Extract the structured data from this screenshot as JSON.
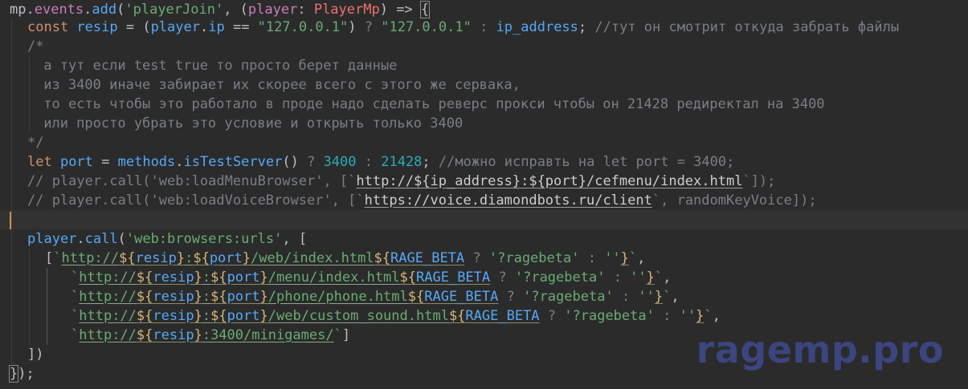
{
  "editor": {
    "theme": "dark",
    "colors": {
      "background": "#2b2b2b",
      "current_line": "#323232",
      "keyword": "#cf8e6d",
      "function": "#56a8f5",
      "property": "#c77dbb",
      "string": "#6aab73",
      "number": "#2aacb8",
      "comment": "#7a7e85",
      "template_interpolation": "#d5b778",
      "type": "#ef6e6e"
    },
    "lines": [
      {
        "tokens": [
          {
            "t": "mp",
            "c": "id"
          },
          {
            "t": ".",
            "c": "op"
          },
          {
            "t": "events",
            "c": "prop"
          },
          {
            "t": ".",
            "c": "op"
          },
          {
            "t": "add",
            "c": "fn"
          },
          {
            "t": "(",
            "c": "par"
          },
          {
            "t": "'playerJoin'",
            "c": "str"
          },
          {
            "t": ", (",
            "c": "op"
          },
          {
            "t": "player",
            "c": "prop"
          },
          {
            "t": ": ",
            "c": "op"
          },
          {
            "t": "PlayerMp",
            "c": "type"
          },
          {
            "t": ") => ",
            "c": "op"
          },
          {
            "t": "{",
            "c": "brace"
          }
        ]
      },
      {
        "tokens": [
          {
            "t": "const ",
            "c": "kw"
          },
          {
            "t": "resip",
            "c": "var"
          },
          {
            "t": " = (",
            "c": "op"
          },
          {
            "t": "player",
            "c": "var"
          },
          {
            "t": ".",
            "c": "op"
          },
          {
            "t": "ip",
            "c": "fn"
          },
          {
            "t": " == ",
            "c": "op"
          },
          {
            "t": "\"127.0.0.1\"",
            "c": "str"
          },
          {
            "t": ") ",
            "c": "op"
          },
          {
            "t": "? ",
            "c": "tern"
          },
          {
            "t": "\"127.0.0.1\"",
            "c": "str"
          },
          {
            "t": " : ",
            "c": "tern"
          },
          {
            "t": "ip_address",
            "c": "var"
          },
          {
            "t": "; ",
            "c": "op"
          },
          {
            "t": "//тут он смотрит откуда забрать файлы",
            "c": "cm"
          }
        ]
      },
      {
        "tokens": [
          {
            "t": "/*",
            "c": "cm"
          }
        ]
      },
      {
        "tokens": [
          {
            "t": " а тут если test true то просто берет данные",
            "c": "cm"
          }
        ]
      },
      {
        "tokens": [
          {
            "t": " из 3400 иначе забирает их скорее всего с этого же сервака,",
            "c": "cm"
          }
        ]
      },
      {
        "tokens": [
          {
            "t": " то есть чтобы это работало в проде надо сделать реверс прокси чтобы он 21428 редиректал на 3400",
            "c": "cm"
          }
        ]
      },
      {
        "tokens": [
          {
            "t": " или просто убрать это условие и открыть только 3400",
            "c": "cm"
          }
        ]
      },
      {
        "tokens": [
          {
            "t": "*/",
            "c": "cm"
          }
        ]
      },
      {
        "tokens": [
          {
            "t": "let ",
            "c": "kw"
          },
          {
            "t": "port",
            "c": "var"
          },
          {
            "t": " = ",
            "c": "op"
          },
          {
            "t": "methods",
            "c": "var"
          },
          {
            "t": ".",
            "c": "op"
          },
          {
            "t": "isTestServer",
            "c": "fn"
          },
          {
            "t": "() ",
            "c": "op"
          },
          {
            "t": "? ",
            "c": "tern"
          },
          {
            "t": "3400",
            "c": "num"
          },
          {
            "t": " : ",
            "c": "tern"
          },
          {
            "t": "21428",
            "c": "num"
          },
          {
            "t": "; ",
            "c": "op"
          },
          {
            "t": "//можно исправть на let port = 3400;",
            "c": "cm"
          }
        ]
      },
      {
        "tokens": [
          {
            "t": "// player.call('web:loadMenuBrowser', [`",
            "c": "cm"
          },
          {
            "t": "http://${ip_address}:${port}/cefmenu/index.html",
            "c": "url"
          },
          {
            "t": "`]);",
            "c": "cm"
          }
        ]
      },
      {
        "tokens": [
          {
            "t": "// player.call('web:loadVoiceBrowser', [`",
            "c": "cm"
          },
          {
            "t": "https://voice.diamondbots.ru/client",
            "c": "url"
          },
          {
            "t": "`, randomKeyVoice]);",
            "c": "cm"
          }
        ]
      },
      {
        "tokens": []
      },
      {
        "tokens": [
          {
            "t": "player",
            "c": "var"
          },
          {
            "t": ".",
            "c": "op"
          },
          {
            "t": "call",
            "c": "fn"
          },
          {
            "t": "(",
            "c": "par"
          },
          {
            "t": "'web:browsers:urls'",
            "c": "str"
          },
          {
            "t": ", [",
            "c": "op"
          }
        ]
      },
      {
        "tokens": [
          {
            "t": "[",
            "c": "op"
          },
          {
            "t": "`",
            "c": "bt"
          },
          {
            "t": "http://",
            "c": "url-s"
          },
          {
            "t": "${",
            "c": "tpl"
          },
          {
            "t": "resip",
            "c": "var"
          },
          {
            "t": "}",
            "c": "tpl"
          },
          {
            "t": ":",
            "c": "url-s"
          },
          {
            "t": "${",
            "c": "tpl"
          },
          {
            "t": "port",
            "c": "var"
          },
          {
            "t": "}",
            "c": "tpl"
          },
          {
            "t": "/web/index.html",
            "c": "url-s"
          },
          {
            "t": "${",
            "c": "tpl"
          },
          {
            "t": "RAGE_BETA",
            "c": "const"
          },
          {
            "t": " ? ",
            "c": "tern"
          },
          {
            "t": "'?ragebeta'",
            "c": "str"
          },
          {
            "t": " : ",
            "c": "tern"
          },
          {
            "t": "''",
            "c": "str"
          },
          {
            "t": "}",
            "c": "tpl"
          },
          {
            "t": "`",
            "c": "bt"
          },
          {
            "t": ",",
            "c": "op"
          }
        ]
      },
      {
        "tokens": [
          {
            "t": "`",
            "c": "bt"
          },
          {
            "t": "http://",
            "c": "url-s"
          },
          {
            "t": "${",
            "c": "tpl"
          },
          {
            "t": "resip",
            "c": "var"
          },
          {
            "t": "}",
            "c": "tpl"
          },
          {
            "t": ":",
            "c": "url-s"
          },
          {
            "t": "${",
            "c": "tpl"
          },
          {
            "t": "port",
            "c": "var"
          },
          {
            "t": "}",
            "c": "tpl"
          },
          {
            "t": "/menu/index.html",
            "c": "url-s"
          },
          {
            "t": "${",
            "c": "tpl"
          },
          {
            "t": "RAGE_BETA",
            "c": "const"
          },
          {
            "t": " ? ",
            "c": "tern"
          },
          {
            "t": "'?ragebeta'",
            "c": "str"
          },
          {
            "t": " : ",
            "c": "tern"
          },
          {
            "t": "''",
            "c": "str"
          },
          {
            "t": "}",
            "c": "tpl"
          },
          {
            "t": "`",
            "c": "bt"
          },
          {
            "t": ",",
            "c": "op"
          }
        ]
      },
      {
        "tokens": [
          {
            "t": "`",
            "c": "bt"
          },
          {
            "t": "http://",
            "c": "url-s"
          },
          {
            "t": "${",
            "c": "tpl"
          },
          {
            "t": "resip",
            "c": "var"
          },
          {
            "t": "}",
            "c": "tpl"
          },
          {
            "t": ":",
            "c": "url-s"
          },
          {
            "t": "${",
            "c": "tpl"
          },
          {
            "t": "port",
            "c": "var"
          },
          {
            "t": "}",
            "c": "tpl"
          },
          {
            "t": "/phone/phone.html",
            "c": "url-s"
          },
          {
            "t": "${",
            "c": "tpl"
          },
          {
            "t": "RAGE_BETA",
            "c": "const"
          },
          {
            "t": " ? ",
            "c": "tern"
          },
          {
            "t": "'?ragebeta'",
            "c": "str"
          },
          {
            "t": " : ",
            "c": "tern"
          },
          {
            "t": "''",
            "c": "str"
          },
          {
            "t": "}",
            "c": "tpl"
          },
          {
            "t": "`",
            "c": "bt"
          },
          {
            "t": ",",
            "c": "op"
          }
        ]
      },
      {
        "tokens": [
          {
            "t": "`",
            "c": "bt"
          },
          {
            "t": "http://",
            "c": "url-s"
          },
          {
            "t": "${",
            "c": "tpl"
          },
          {
            "t": "resip",
            "c": "var"
          },
          {
            "t": "}",
            "c": "tpl"
          },
          {
            "t": ":",
            "c": "url-s"
          },
          {
            "t": "${",
            "c": "tpl"
          },
          {
            "t": "port",
            "c": "var"
          },
          {
            "t": "}",
            "c": "tpl"
          },
          {
            "t": "/web/custom_sound.html",
            "c": "url-s"
          },
          {
            "t": "${",
            "c": "tpl"
          },
          {
            "t": "RAGE_BETA",
            "c": "const"
          },
          {
            "t": " ? ",
            "c": "tern"
          },
          {
            "t": "'?ragebeta'",
            "c": "str"
          },
          {
            "t": " : ",
            "c": "tern"
          },
          {
            "t": "''",
            "c": "str"
          },
          {
            "t": "}",
            "c": "tpl"
          },
          {
            "t": "`",
            "c": "bt"
          },
          {
            "t": ",",
            "c": "op"
          }
        ]
      },
      {
        "tokens": [
          {
            "t": "`",
            "c": "bt"
          },
          {
            "t": "http://",
            "c": "url-s"
          },
          {
            "t": "${",
            "c": "tpl"
          },
          {
            "t": "resip",
            "c": "var"
          },
          {
            "t": "}",
            "c": "tpl"
          },
          {
            "t": ":3400/minigames/",
            "c": "url-s"
          },
          {
            "t": "`",
            "c": "bt"
          },
          {
            "t": "]",
            "c": "op"
          }
        ]
      },
      {
        "tokens": [
          {
            "t": "])",
            "c": "op"
          }
        ]
      },
      {
        "tokens": [
          {
            "t": "}",
            "c": "brace"
          },
          {
            "t": ");",
            "c": "op"
          }
        ]
      }
    ]
  },
  "watermark": {
    "text": "ragemp.pro",
    "color": "#3e4a8e"
  }
}
